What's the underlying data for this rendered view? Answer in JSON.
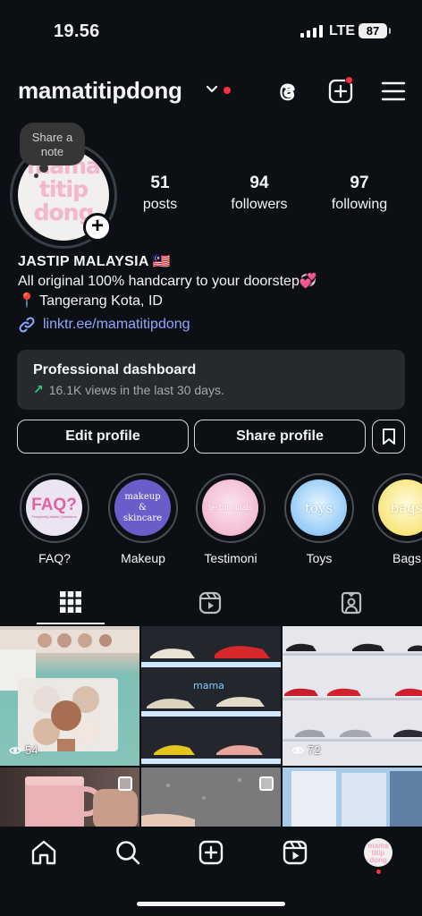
{
  "status": {
    "time": "19.56",
    "network": "LTE",
    "battery": "87"
  },
  "header": {
    "username": "mamatitipdong"
  },
  "profile": {
    "avatar_text": "mama titip dong",
    "note_prompt": "Share a note",
    "stats": [
      {
        "value": "51",
        "label": "posts"
      },
      {
        "value": "94",
        "label": "followers"
      },
      {
        "value": "97",
        "label": "following"
      }
    ],
    "name": "JASTIP MALAYSIA 🇲🇾",
    "bio_line": "All original 100% handcarry to your doorstep💞",
    "location": "📍 Tangerang Kota, ID",
    "link": "linktr.ee/mamatitipdong"
  },
  "dashboard": {
    "title": "Professional dashboard",
    "subtitle": "16.1K views in the last 30 days."
  },
  "buttons": {
    "edit": "Edit profile",
    "share": "Share profile"
  },
  "highlights": [
    {
      "label": "FAQ?",
      "cover_text": "FAQ?",
      "cover_sub": "Frequently Asked Questions",
      "bg": "#e9e2f2",
      "fg": "#e06aa8"
    },
    {
      "label": "Makeup",
      "cover_text": "makeup & skincare",
      "bg": "#6a5cc9",
      "fg": "#ffffff"
    },
    {
      "label": "Testimoni",
      "cover_text": "testimonials",
      "bg": "#f4c3d8",
      "fg": "#ffffff"
    },
    {
      "label": "Toys",
      "cover_text": "toys",
      "bg": "#9ed0f7",
      "fg": "#ffffff"
    },
    {
      "label": "Bags",
      "cover_text": "bags",
      "bg": "#fbe98a",
      "fg": "#ffffff"
    }
  ],
  "posts": [
    {
      "views": "54"
    },
    {
      "views": ""
    },
    {
      "views": "72"
    }
  ],
  "colors": {
    "accent_link": "#8ea7ff",
    "notification": "#ff3040",
    "background": "#0c1014",
    "card": "#262a2e"
  }
}
